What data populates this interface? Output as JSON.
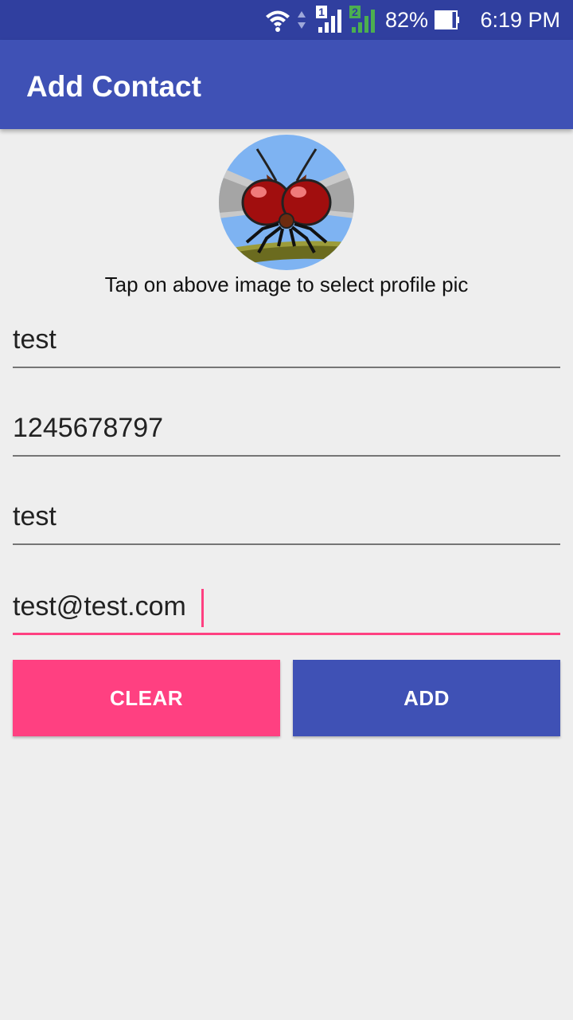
{
  "status_bar": {
    "time": "6:19 PM",
    "battery_percent": "82%",
    "battery_level": 0.82,
    "sim1_label": "1",
    "sim2_label": "2",
    "icons": [
      "wifi-icon",
      "data-arrows-icon",
      "sim1-signal-icon",
      "sim2-signal-icon",
      "battery-icon"
    ],
    "colors": {
      "background": "#303f9f",
      "sim2_accent": "#4caf50"
    }
  },
  "app_bar": {
    "title": "Add Contact",
    "color": "#3f51b5"
  },
  "profile": {
    "hint": "Tap on above image to select profile pic"
  },
  "form": {
    "name_value": "test",
    "phone_value": "1245678797",
    "field3_value": "test",
    "email_value": "test@test.com"
  },
  "buttons": {
    "clear_label": "CLEAR",
    "add_label": "ADD",
    "clear_color": "#ff4081",
    "add_color": "#3f51b5"
  }
}
